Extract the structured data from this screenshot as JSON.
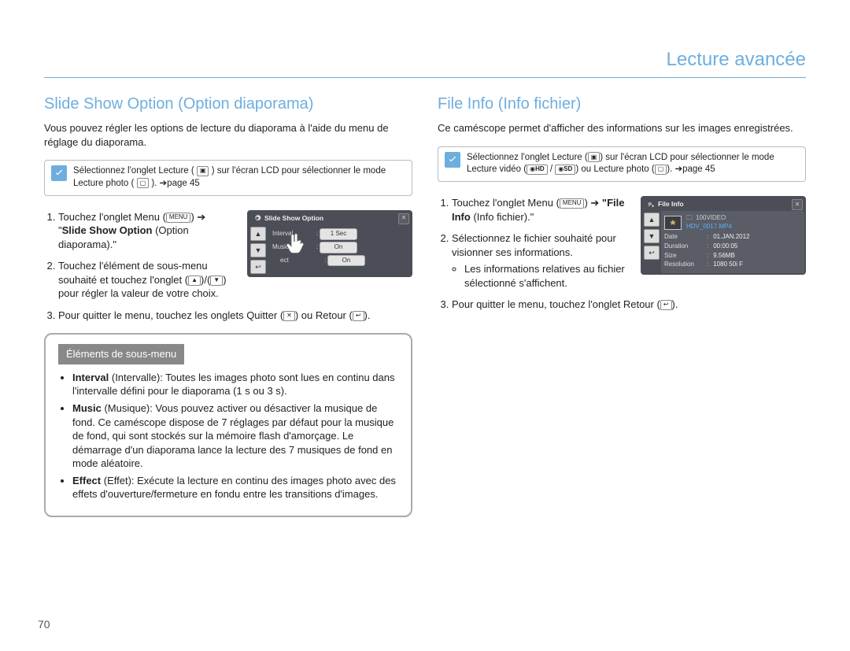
{
  "header": {
    "section": "Lecture avancée"
  },
  "pagenum": "70",
  "left": {
    "title": "Slide Show Option (Option diaporama)",
    "intro": "Vous pouvez régler les options de lecture du diaporama à l'aide du menu de réglage du diaporama.",
    "note_a": "Sélectionnez l'onglet Lecture (",
    "note_b": ") sur l'écran LCD pour sélectionner le mode Lecture photo (",
    "note_c": "). ➔page 45",
    "step1a": "Touchez l'onglet Menu (",
    "step1b": ") ➔ \"",
    "step1_bold": "Slide Show Option",
    "step1c": " (Option diaporama).\"",
    "step2a": "Touchez l'élément de sous-menu souhaité et touchez l'onglet (",
    "step2b": ")/(",
    "step2c": ") pour régler la valeur de votre choix.",
    "step3a": "Pour quitter le menu, touchez les onglets Quitter (",
    "step3b": ") ou Retour (",
    "step3c": ").",
    "lcd": {
      "title": "Slide Show Option",
      "rows": [
        {
          "label": "Interval",
          "value": "1 Sec"
        },
        {
          "label": "Music",
          "value": "On"
        },
        {
          "label": "Effect",
          "value": "On"
        }
      ]
    },
    "submenu_title": "Éléments de sous-menu",
    "submenu": [
      {
        "bold": "Interval",
        "rest": " (Intervalle): Toutes les images photo sont lues en continu dans l'intervalle défini pour le diaporama (1 s ou 3 s)."
      },
      {
        "bold": "Music",
        "rest": " (Musique): Vous pouvez activer ou désactiver la musique de fond. Ce caméscope dispose de 7 réglages par défaut pour la musique de fond, qui sont stockés sur la mémoire flash d'amorçage. Le démarrage d'un diaporama lance la lecture des 7 musiques de fond en mode aléatoire."
      },
      {
        "bold": "Effect",
        "rest": " (Effet): Exécute la lecture en continu des images photo avec des effets d'ouverture/fermeture en fondu entre les transitions d'images."
      }
    ]
  },
  "right": {
    "title": "File Info (Info fichier)",
    "intro": "Ce caméscope permet d'afficher des informations sur les images enregistrées.",
    "note_a": "Sélectionnez l'onglet Lecture (",
    "note_b": ") sur l'écran LCD pour sélectionner le mode Lecture vidéo (",
    "note_hd": "HD",
    "note_c": " / ",
    "note_sd": "SD",
    "note_d": ") ou Lecture photo (",
    "note_e": "). ➔page 45",
    "step1a": "Touchez l'onglet Menu (",
    "step1b": ") ➔ ",
    "step1_bold": "\"File Info",
    "step1_rest": " (Info fichier).\"",
    "step2": "Sélectionnez le fichier souhaité pour visionner ses informations.",
    "step2_bullet": "Les informations relatives au fichier sélectionné s'affichent.",
    "step3a": "Pour quitter le menu, touchez l'onglet Retour (",
    "step3b": ").",
    "lcd": {
      "title": "File Info",
      "folder": "100VIDEO",
      "filename": "HDV_0017.MP4",
      "rows": [
        {
          "k": "Date",
          "v": "01.JAN.2012"
        },
        {
          "k": "Duration",
          "v": "00:00:05"
        },
        {
          "k": "Size",
          "v": "9.56MB"
        },
        {
          "k": "Resolution",
          "v": "1080 50i F"
        }
      ]
    }
  },
  "icons": {
    "menu": "MENU",
    "up": "▲",
    "down": "▼",
    "back": "↩",
    "close": "✕",
    "play": "▶",
    "photo": "👤"
  }
}
